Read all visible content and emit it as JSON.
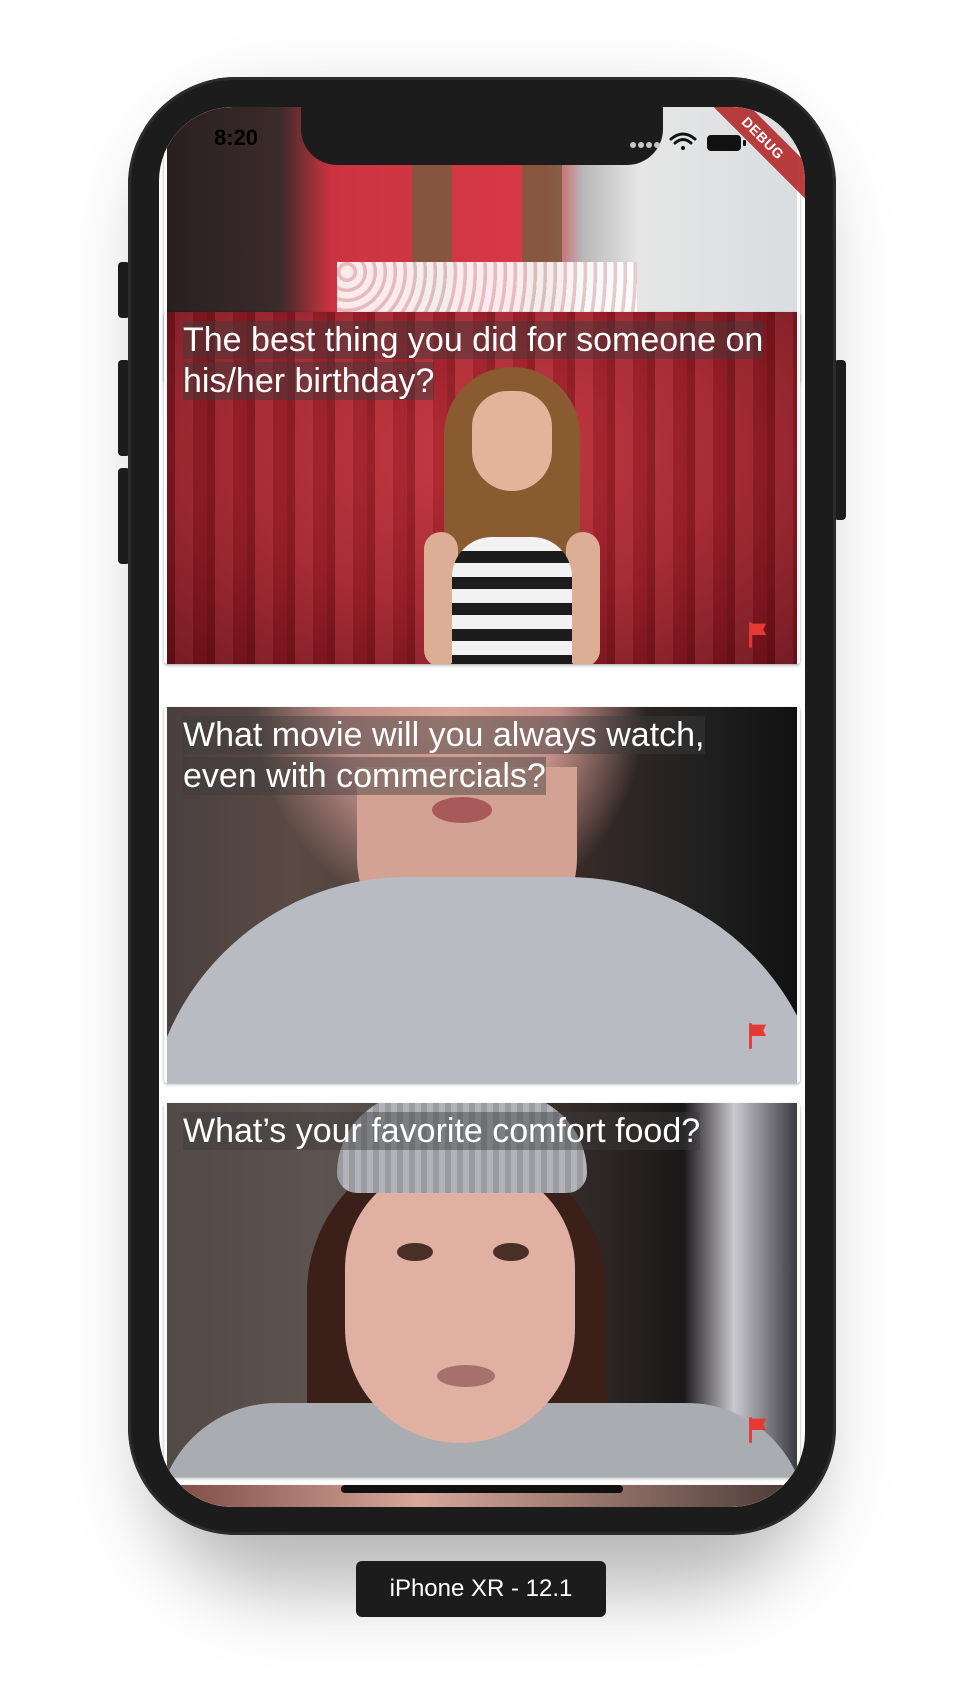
{
  "status_bar": {
    "time": "8:20"
  },
  "debug_banner": "DEBUG",
  "accent": {
    "flag_color": "#e53935"
  },
  "feed": [
    {
      "question": ""
    },
    {
      "question": "The best thing you did for someone on his/her birthday?"
    },
    {
      "question": "What movie will you always watch, even with commercials?"
    },
    {
      "question": "What’s your favorite comfort food?"
    },
    {
      "question": ""
    }
  ],
  "icons": {
    "flag": "flag-icon",
    "wifi": "wifi-icon",
    "battery": "battery-icon",
    "signal": "signal-icon"
  },
  "simulator_label": "iPhone XR - 12.1"
}
